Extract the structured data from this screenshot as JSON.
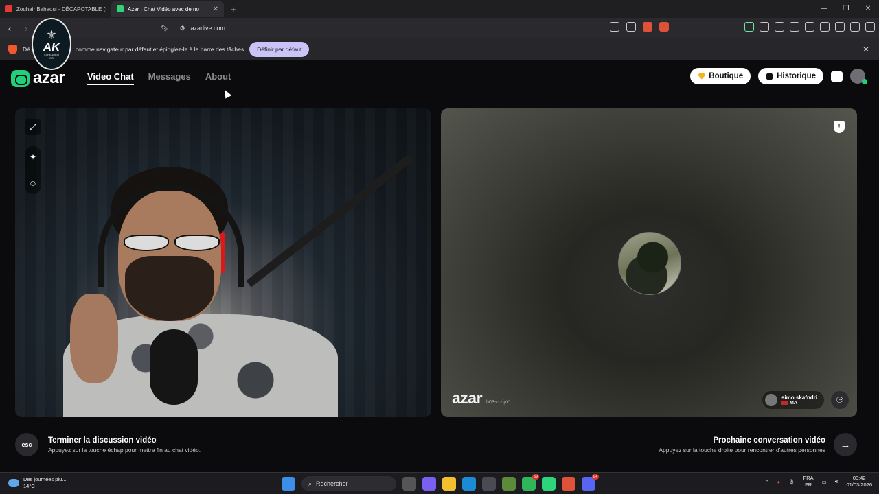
{
  "browser": {
    "tabs": [
      {
        "title": "Zouhair Bahaoui - DÉCAPOTABLE (EX",
        "active": false
      },
      {
        "title": "Azar : Chat Vidéo avec de no",
        "active": true
      }
    ],
    "url": "azarlive.com",
    "infobar": {
      "text_pre": "Dé",
      "text": "comme navigateur par défaut et épinglez-le à la barre des tâches",
      "button": "Définir par défaut"
    }
  },
  "overlay_logo": {
    "text": "AK",
    "subtext": "STREAMER",
    "subtext2": "GO"
  },
  "site": {
    "brand": "azar",
    "nav": [
      "Video Chat",
      "Messages",
      "About"
    ],
    "active_nav": "Video Chat",
    "boutique_label": "Boutique",
    "history_label": "Historique"
  },
  "partner": {
    "watermark": "azar",
    "session_code": "b03-zc-fpY",
    "name": "simo skafndri",
    "country": "MA"
  },
  "controls": {
    "esc_key": "esc",
    "end_title": "Terminer la discussion vidéo",
    "end_sub": "Appuyez sur la touche échap pour mettre fin au chat vidéo.",
    "next_title": "Prochaine conversation vidéo",
    "next_sub": "Appuyez sur la touche droite pour rencontrer d'autres personnes"
  },
  "taskbar": {
    "weather_text": "Des journées plu...",
    "temp": "14°C",
    "search_label": "Rechercher",
    "badges": {
      "whatsapp": "59",
      "discord": "9+"
    },
    "lang1": "FRA",
    "lang2": "FR",
    "time": "00:42",
    "date": "01/03/2026"
  }
}
